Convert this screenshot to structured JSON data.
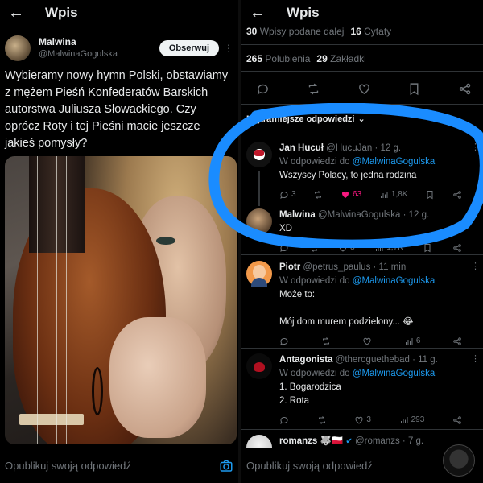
{
  "left": {
    "title": "Wpis",
    "author": {
      "name": "Malwina",
      "handle": "@MalwinaGogulska"
    },
    "follow_label": "Obserwuj",
    "text": "Wybieramy nowy hymn Polski, obstawiamy z mężem Pieśń Konfederatów Barskich autorstwa Juliusza Słowackiego. Czy oprócz Roty i tej Pieśni macie jeszcze jakieś pomysły?",
    "reply_placeholder": "Opublikuj swoją odpowiedź"
  },
  "right": {
    "title": "Wpis",
    "stats": {
      "reposts_count": "30",
      "reposts_label": "Wpisy podane dalej",
      "quotes_count": "16",
      "quotes_label": "Cytaty",
      "likes_count": "265",
      "likes_label": "Polubienia",
      "bookmarks_count": "29",
      "bookmarks_label": "Zakładki"
    },
    "sort_label": "Najtrafniejsze odpowiedzi",
    "reply_to_prefix": "W odpowiedzi do",
    "replies": [
      {
        "name": "Jan Hucuł",
        "handle": "@HucuJan",
        "time": "· 12 g.",
        "reply_to": "@MalwinaGogulska",
        "text": "Wszyscy Polacy, to jedna rodzina",
        "comments": "3",
        "likes": "63",
        "views": "1,8K"
      },
      {
        "name": "Malwina",
        "handle": "@MalwinaGogulska",
        "time": "· 12 g.",
        "text": "XD",
        "likes": "8",
        "views": "1,7K"
      },
      {
        "name": "Piotr",
        "handle": "@petrus_paulus",
        "time": "· 11 min",
        "reply_to": "@MalwinaGogulska",
        "text": "Może to:\n\nMój dom murem podzielony... 😂",
        "views": "6"
      },
      {
        "name": "Antagonista",
        "handle": "@theroguethebad",
        "time": "· 11 g.",
        "reply_to": "@MalwinaGogulska",
        "text": "1. Bogarodzica\n2. Rota",
        "likes": "3",
        "views": "293"
      },
      {
        "name": "romanzs",
        "badges": "🐺🇵🇱",
        "handle": "@romanzs",
        "time": "· 7 g."
      }
    ],
    "reply_placeholder": "Opublikuj swoją odpowiedź"
  },
  "colors": {
    "accent": "#1d9bf0",
    "like": "#f91880",
    "muted": "#71767b",
    "annotation": "#1a8cff"
  }
}
